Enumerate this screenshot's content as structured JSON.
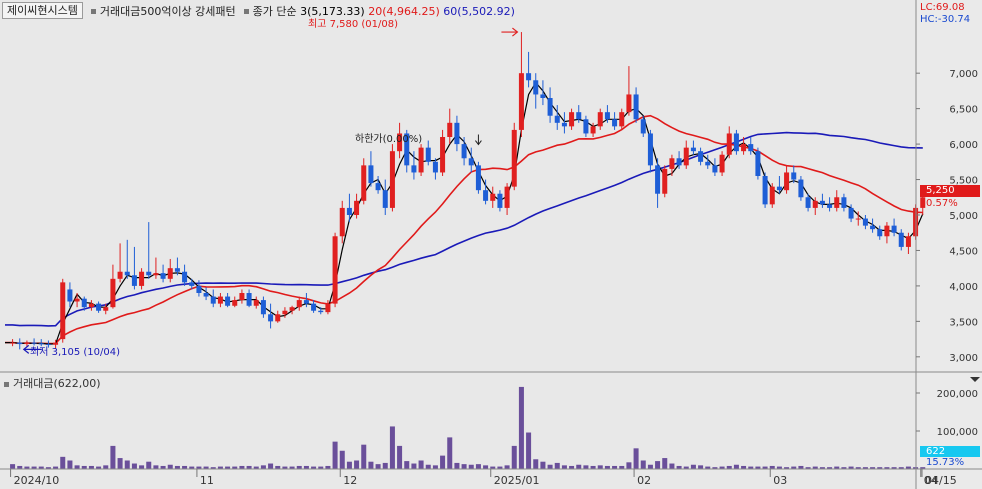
{
  "app": {
    "stock_name": "제이씨현시스템",
    "condition": "거래대금500억이상 강세패턴",
    "ma_label": "종가 단순",
    "ma3": "3(5,173.33)",
    "ma20": "20(4,964.25)",
    "ma60": "60(5,502.92)"
  },
  "top_right": {
    "lc": "LC:69.08",
    "hc": "HC:-30.74"
  },
  "annotations": {
    "high": "최고 7,580 (01/08)",
    "low": "최저 3,105 (10/04)",
    "limit_down": "하한가(0.00%)"
  },
  "current": {
    "price": "5,250",
    "change": "0.57%"
  },
  "volume_panel": {
    "title": "거래대금(622,00)",
    "current": "622",
    "change": "15.73%"
  },
  "colors": {
    "up": "#e02020",
    "down": "#1e5ed6",
    "ma3": "#000000",
    "ma20": "#e01a1a",
    "ma60": "#1a1ab8",
    "highlight": "#ffc0f4",
    "volume": "#6a4f9a"
  },
  "chart_data": {
    "type": "candlestick",
    "price_axis": {
      "ticks": [
        3000,
        3500,
        4000,
        4500,
        5000,
        5500,
        6000,
        6500,
        7000
      ],
      "tick_labels": [
        "3,000",
        "3,500",
        "4,000",
        "4,500",
        "5,000",
        "5,500",
        "6,000",
        "6,500",
        "7,000"
      ],
      "ylim": [
        2800,
        7750
      ]
    },
    "volume_axis": {
      "ticks": [
        100000,
        200000
      ],
      "tick_labels": [
        "100,000",
        "200,000"
      ],
      "ylim": [
        0,
        250000
      ]
    },
    "x_labels": [
      "2024/10",
      "11",
      "12",
      "2025/01",
      "02",
      "03",
      "04",
      "04/15"
    ],
    "sessions": 126,
    "x_label_sessions": [
      0,
      26,
      46,
      67,
      87,
      106,
      127
    ],
    "highlight_sessions": [
      7,
      14,
      15,
      44,
      49,
      53,
      57,
      62,
      70,
      71,
      72,
      91
    ],
    "high": {
      "value": 7580,
      "session": 71
    },
    "low": {
      "value": 3105,
      "session": 1
    },
    "limit_down_session": 65,
    "candles": [
      [
        3200,
        3250,
        3150,
        3200
      ],
      [
        3200,
        3260,
        3105,
        3180
      ],
      [
        3180,
        3230,
        3140,
        3200
      ],
      [
        3200,
        3260,
        3160,
        3190
      ],
      [
        3190,
        3250,
        3150,
        3180
      ],
      [
        3180,
        3230,
        3130,
        3170
      ],
      [
        3170,
        3240,
        3120,
        3200
      ],
      [
        3250,
        4100,
        3200,
        4050
      ],
      [
        3950,
        4050,
        3700,
        3780
      ],
      [
        3780,
        3900,
        3700,
        3820
      ],
      [
        3820,
        3850,
        3650,
        3700
      ],
      [
        3700,
        3800,
        3650,
        3750
      ],
      [
        3750,
        3780,
        3620,
        3650
      ],
      [
        3650,
        3750,
        3600,
        3700
      ],
      [
        3700,
        4300,
        3680,
        4100
      ],
      [
        4100,
        4600,
        4050,
        4200
      ],
      [
        4200,
        4650,
        4100,
        4150
      ],
      [
        4150,
        4550,
        3950,
        4000
      ],
      [
        4000,
        4250,
        3950,
        4200
      ],
      [
        4200,
        4900,
        4100,
        4150
      ],
      [
        4150,
        4400,
        4100,
        4180
      ],
      [
        4180,
        4300,
        4050,
        4100
      ],
      [
        4100,
        4380,
        4050,
        4250
      ],
      [
        4250,
        4400,
        4150,
        4200
      ],
      [
        4200,
        4300,
        4000,
        4050
      ],
      [
        4050,
        4100,
        3950,
        4000
      ],
      [
        4000,
        4080,
        3850,
        3900
      ],
      [
        3900,
        3980,
        3800,
        3850
      ],
      [
        3850,
        3950,
        3700,
        3750
      ],
      [
        3750,
        3900,
        3700,
        3850
      ],
      [
        3850,
        3900,
        3700,
        3720
      ],
      [
        3720,
        3850,
        3700,
        3800
      ],
      [
        3800,
        3950,
        3750,
        3900
      ],
      [
        3900,
        3950,
        3700,
        3720
      ],
      [
        3720,
        3850,
        3680,
        3800
      ],
      [
        3800,
        3850,
        3550,
        3600
      ],
      [
        3600,
        3750,
        3400,
        3500
      ],
      [
        3500,
        3650,
        3480,
        3600
      ],
      [
        3600,
        3700,
        3550,
        3650
      ],
      [
        3650,
        3720,
        3600,
        3700
      ],
      [
        3700,
        3850,
        3650,
        3800
      ],
      [
        3800,
        3900,
        3700,
        3750
      ],
      [
        3750,
        3800,
        3620,
        3650
      ],
      [
        3650,
        3700,
        3600,
        3630
      ],
      [
        3630,
        3800,
        3600,
        3750
      ],
      [
        3750,
        4750,
        3700,
        4700
      ],
      [
        4700,
        5200,
        4600,
        5100
      ],
      [
        5100,
        5300,
        4900,
        5000
      ],
      [
        5000,
        5300,
        4950,
        5200
      ],
      [
        5200,
        5800,
        5150,
        5700
      ],
      [
        5700,
        5900,
        5400,
        5450
      ],
      [
        5450,
        5550,
        5300,
        5350
      ],
      [
        5350,
        5500,
        5000,
        5100
      ],
      [
        5100,
        6000,
        5050,
        5900
      ],
      [
        5900,
        6300,
        5800,
        6150
      ],
      [
        6150,
        6200,
        5600,
        5700
      ],
      [
        5700,
        5900,
        5500,
        5600
      ],
      [
        5600,
        6000,
        5550,
        5950
      ],
      [
        5950,
        6050,
        5700,
        5750
      ],
      [
        5750,
        5800,
        5500,
        5600
      ],
      [
        5600,
        6200,
        5550,
        6100
      ],
      [
        6100,
        6500,
        6000,
        6300
      ],
      [
        6300,
        6400,
        5900,
        6000
      ],
      [
        6000,
        6100,
        5700,
        5800
      ],
      [
        5800,
        5950,
        5600,
        5700
      ],
      [
        5700,
        5750,
        5300,
        5350
      ],
      [
        5350,
        5500,
        5150,
        5200
      ],
      [
        5200,
        5400,
        5100,
        5300
      ],
      [
        5300,
        5350,
        5050,
        5100
      ],
      [
        5100,
        5450,
        5000,
        5400
      ],
      [
        5400,
        6300,
        5350,
        6200
      ],
      [
        6200,
        7580,
        6100,
        7000
      ],
      [
        7000,
        7300,
        6800,
        6900
      ],
      [
        6900,
        7000,
        6500,
        6700
      ],
      [
        6700,
        6900,
        6550,
        6650
      ],
      [
        6650,
        6800,
        6300,
        6400
      ],
      [
        6400,
        6550,
        6200,
        6300
      ],
      [
        6300,
        6450,
        6150,
        6250
      ],
      [
        6250,
        6500,
        6200,
        6450
      ],
      [
        6450,
        6550,
        6300,
        6350
      ],
      [
        6350,
        6400,
        6100,
        6150
      ],
      [
        6150,
        6300,
        6100,
        6250
      ],
      [
        6250,
        6500,
        6200,
        6450
      ],
      [
        6450,
        6550,
        6300,
        6350
      ],
      [
        6350,
        6450,
        6200,
        6250
      ],
      [
        6250,
        6500,
        6200,
        6450
      ],
      [
        6450,
        7100,
        6400,
        6700
      ],
      [
        6700,
        6800,
        6300,
        6350
      ],
      [
        6350,
        6400,
        6100,
        6150
      ],
      [
        6150,
        6200,
        5600,
        5700
      ],
      [
        5700,
        5800,
        5100,
        5300
      ],
      [
        5300,
        5700,
        5250,
        5650
      ],
      [
        5650,
        5850,
        5550,
        5800
      ],
      [
        5800,
        5900,
        5650,
        5700
      ],
      [
        5700,
        6050,
        5650,
        5950
      ],
      [
        5950,
        6050,
        5850,
        5900
      ],
      [
        5900,
        5950,
        5700,
        5750
      ],
      [
        5750,
        5850,
        5650,
        5700
      ],
      [
        5700,
        5800,
        5550,
        5600
      ],
      [
        5600,
        5900,
        5550,
        5850
      ],
      [
        5850,
        6250,
        5800,
        6150
      ],
      [
        6150,
        6200,
        5850,
        5900
      ],
      [
        5900,
        6100,
        5850,
        6000
      ],
      [
        6000,
        6100,
        5850,
        5900
      ],
      [
        5900,
        5950,
        5500,
        5550
      ],
      [
        5550,
        5600,
        5100,
        5150
      ],
      [
        5150,
        5450,
        5100,
        5400
      ],
      [
        5400,
        5550,
        5300,
        5350
      ],
      [
        5350,
        5700,
        5300,
        5600
      ],
      [
        5600,
        5700,
        5450,
        5500
      ],
      [
        5500,
        5550,
        5200,
        5250
      ],
      [
        5250,
        5300,
        5050,
        5100
      ],
      [
        5100,
        5250,
        5000,
        5200
      ],
      [
        5200,
        5300,
        5100,
        5150
      ],
      [
        5150,
        5250,
        5050,
        5100
      ],
      [
        5100,
        5350,
        5050,
        5250
      ],
      [
        5250,
        5300,
        5050,
        5100
      ],
      [
        5100,
        5150,
        4900,
        4950
      ],
      [
        4950,
        5050,
        4850,
        4950
      ],
      [
        4950,
        5000,
        4800,
        4850
      ],
      [
        4850,
        4950,
        4750,
        4800
      ],
      [
        4800,
        4850,
        4650,
        4700
      ],
      [
        4700,
        4900,
        4600,
        4850
      ],
      [
        4850,
        4950,
        4700,
        4750
      ],
      [
        4750,
        4800,
        4500,
        4550
      ],
      [
        4550,
        4750,
        4450,
        4700
      ],
      [
        4700,
        5150,
        4650,
        5100
      ],
      [
        5100,
        5350,
        5000,
        5250
      ]
    ],
    "volume": [
      8,
      5,
      4,
      4,
      4,
      3,
      4,
      20,
      14,
      6,
      5,
      5,
      4,
      6,
      38,
      18,
      14,
      9,
      6,
      12,
      6,
      5,
      7,
      5,
      5,
      4,
      4,
      4,
      3,
      4,
      4,
      4,
      5,
      5,
      4,
      6,
      9,
      5,
      4,
      4,
      5,
      5,
      4,
      4,
      5,
      45,
      30,
      12,
      14,
      40,
      12,
      8,
      10,
      70,
      38,
      13,
      9,
      14,
      7,
      6,
      22,
      52,
      10,
      8,
      7,
      8,
      6,
      4,
      4,
      6,
      38,
      135,
      60,
      16,
      12,
      7,
      10,
      6,
      5,
      7,
      6,
      5,
      6,
      5,
      5,
      5,
      11,
      34,
      14,
      7,
      13,
      18,
      9,
      5,
      4,
      7,
      6,
      4,
      3,
      4,
      5,
      7,
      5,
      4,
      4,
      4,
      5,
      4,
      3,
      4,
      5,
      3,
      4,
      3,
      3,
      4,
      3,
      4,
      3,
      3,
      3,
      3,
      3,
      3,
      3,
      4,
      3,
      3
    ]
  }
}
